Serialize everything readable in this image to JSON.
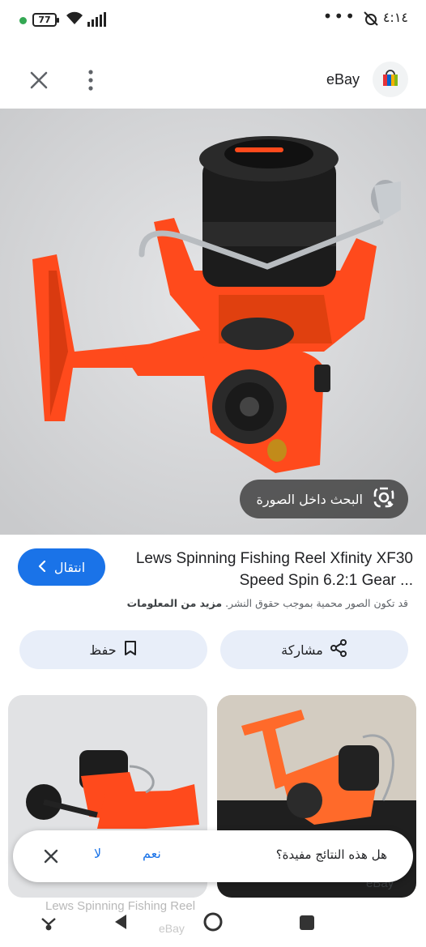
{
  "status_bar": {
    "battery": "77",
    "time": "٤:١٤",
    "menu_dots": "•••"
  },
  "header": {
    "site_name": "eBay"
  },
  "image_overlay": {
    "lens_label": "البحث داخل الصورة"
  },
  "result": {
    "title": "Lews Spinning Fishing Reel Xfinity XF30 Speed Spin 6.2:1 Gear ...",
    "visit_label": "انتقال",
    "copyright_text": "قد تكون الصور محمية بموجب حقوق النشر.",
    "learn_more": "مزيد من المعلومات",
    "share_label": "مشاركة",
    "save_label": "حفظ"
  },
  "related": {
    "left_caption": "Lews Spinning Fishing Reel",
    "left_source": "eBay",
    "right_source": "eBay"
  },
  "feedback": {
    "question": "هل هذه النتائج مفيدة؟",
    "yes": "نعم",
    "no": "لا"
  },
  "colors": {
    "accent": "#1a73e8",
    "reel_orange": "#ff4a1c",
    "action_button_bg": "#e8eef9"
  },
  "icons": [
    "wifi-icon",
    "signal-icon",
    "alarm-off-icon",
    "close-icon",
    "more-vert-icon",
    "shopping-bag-icon",
    "lens-icon",
    "chevron-left-icon",
    "share-icon",
    "bookmark-icon",
    "nav-back-icon",
    "nav-home-icon",
    "nav-recents-icon"
  ]
}
